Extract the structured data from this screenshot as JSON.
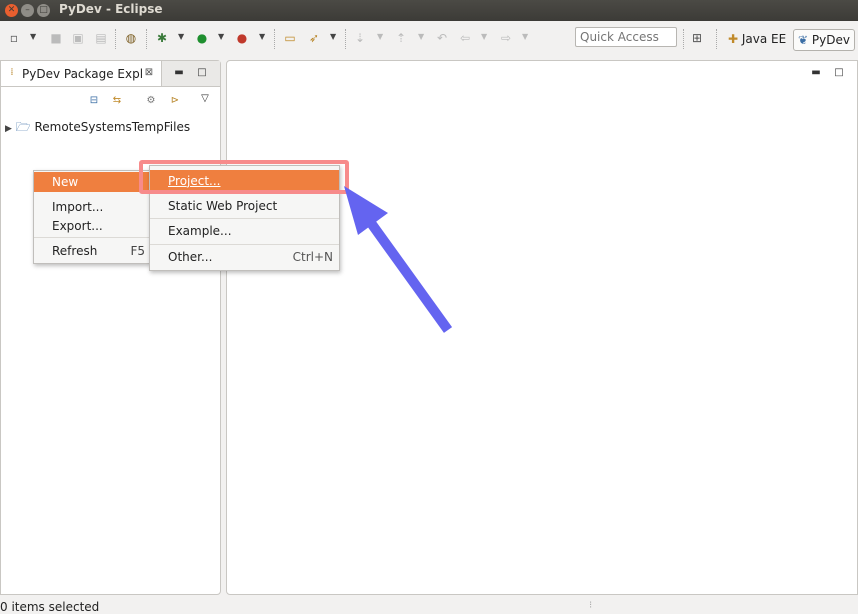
{
  "window": {
    "title": "PyDev - Eclipse"
  },
  "toolbar": {
    "quick_access_placeholder": "Quick Access",
    "perspectives": [
      {
        "label": "Java EE"
      },
      {
        "label": "PyDev"
      }
    ]
  },
  "explorer": {
    "tab_label": "PyDev Package Expl",
    "tree_items": [
      {
        "label": "RemoteSystemsTempFiles"
      }
    ]
  },
  "context_menu": {
    "items": [
      {
        "label": "New",
        "shortcut": ""
      },
      {
        "label": "Import...",
        "shortcut": ""
      },
      {
        "label": "Export...",
        "shortcut": ""
      },
      {
        "label": "Refresh",
        "shortcut": "F5"
      }
    ]
  },
  "submenu": {
    "items": [
      {
        "label": "Project...",
        "shortcut": ""
      },
      {
        "label": "Static Web Project",
        "shortcut": ""
      },
      {
        "label": "Example...",
        "shortcut": ""
      },
      {
        "label": "Other...",
        "shortcut": "Ctrl+N"
      }
    ]
  },
  "status_bar": {
    "text": "0 items selected"
  },
  "colors": {
    "menu_highlight": "#ef7f3f",
    "annotation_box": "#f78b8b",
    "annotation_arrow": "#6464f0"
  }
}
